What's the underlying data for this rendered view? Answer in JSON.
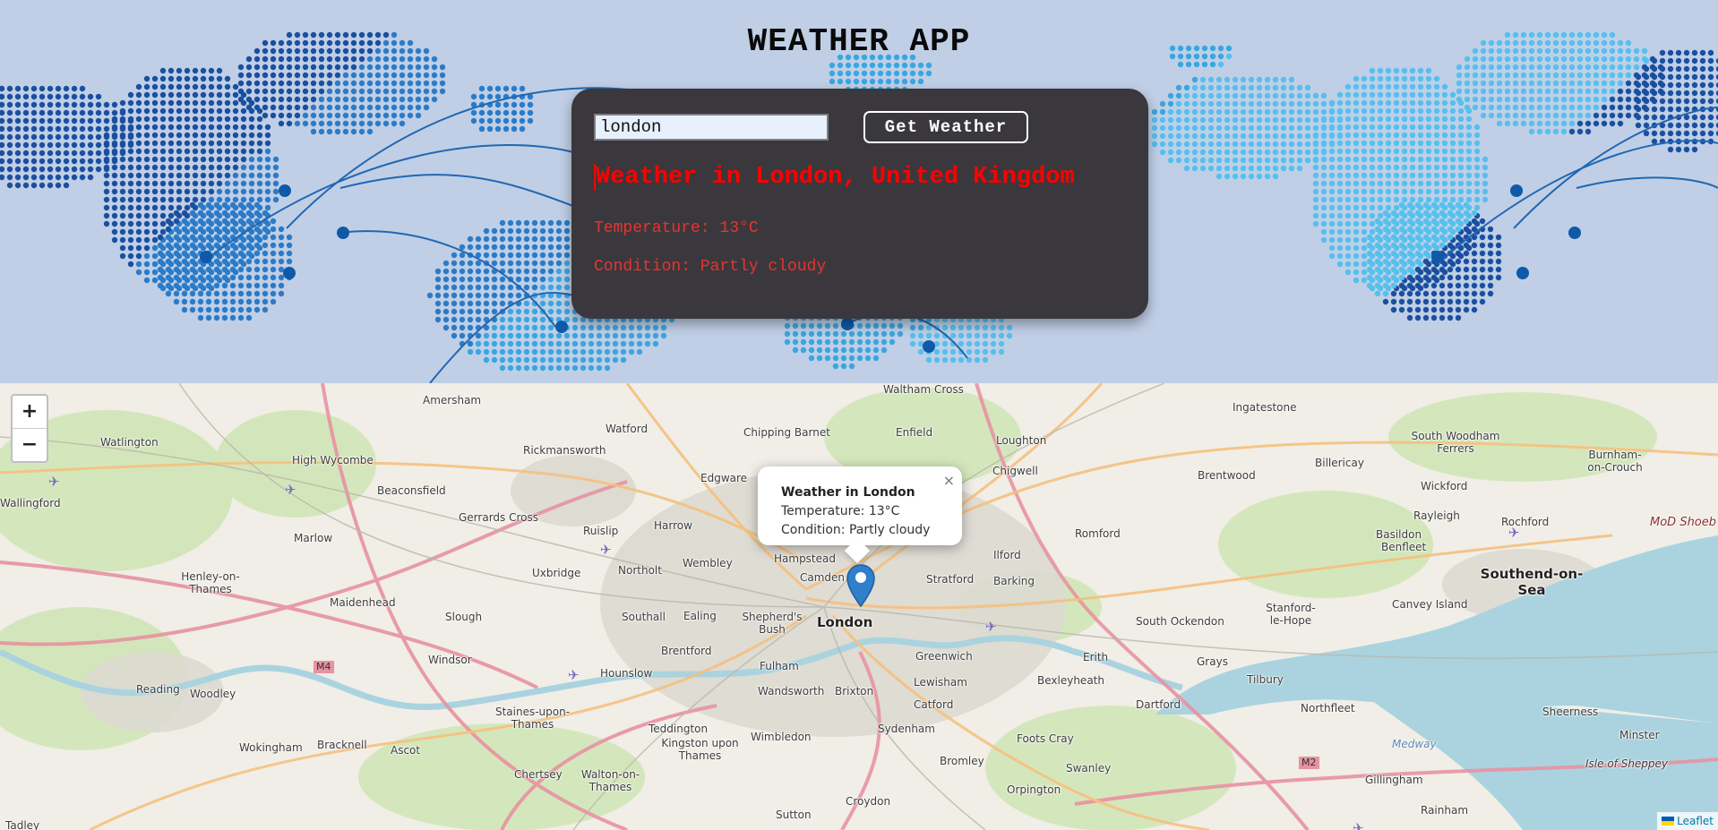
{
  "app": {
    "title": "WEATHER APP"
  },
  "search": {
    "value": "london",
    "button_label": "Get Weather"
  },
  "weather": {
    "heading": "Weather in London, United Kingdom",
    "temperature": "Temperature: 13°C",
    "condition": "Condition: Partly cloudy"
  },
  "map": {
    "zoom_in": "+",
    "zoom_out": "−",
    "popup": {
      "title": "Weather in London",
      "temperature": "Temperature: 13°C",
      "condition": "Condition: Partly cloudy",
      "close": "×"
    },
    "attribution": "Leaflet",
    "places": [
      "Waltham Cross",
      "Amersham",
      "Watford",
      "Chipping Barnet",
      "Enfield",
      "Loughton",
      "Ingatestone",
      "South Woodham Ferrers",
      "Burnham-on-Crouch",
      "Watlington",
      "High Wycombe",
      "Rickmansworth",
      "Edgware",
      "Chigwell",
      "Brentwood",
      "Billericay",
      "Wickford",
      "Wallingford",
      "Beaconsfield",
      "Gerrards Cross",
      "Ruislip",
      "Harrow",
      "Romford",
      "Rayleigh",
      "Rochford",
      "MoD Shoeb",
      "Marlow",
      "Hampstead",
      "Basildon",
      "Benfleet",
      "Henley-on-Thames",
      "Uxbridge",
      "Northolt",
      "Wembley",
      "Camden",
      "Stratford",
      "Ilford",
      "Barking",
      "Southend-on-Sea",
      "Maidenhead",
      "Slough",
      "Southall",
      "Ealing",
      "Shepherd's Bush",
      "London",
      "Stanford-le-Hope",
      "Canvey Island",
      "South Ockendon",
      "Windsor",
      "Hounslow",
      "Brentford",
      "Fulham",
      "Greenwich",
      "Erith",
      "Grays",
      "Tilbury",
      "Reading",
      "Woodley",
      "Wandsworth",
      "Brixton",
      "Lewisham",
      "Bexleyheath",
      "Dartford",
      "Northfleet",
      "Sheerness",
      "Staines-upon-Thames",
      "Teddington",
      "Kingston upon Thames",
      "Wimbledon",
      "Catford",
      "Sydenham",
      "Minster",
      "Wokingham",
      "Bracknell",
      "Ascot",
      "Bromley",
      "Foots Cray",
      "Medway",
      "Isle of Sheppey",
      "Chertsey",
      "Walton-on-Thames",
      "Swanley",
      "Gillingham",
      "Orpington",
      "Sutton",
      "Croydon",
      "Rainham",
      "Tadley",
      "M4",
      "M2"
    ]
  }
}
